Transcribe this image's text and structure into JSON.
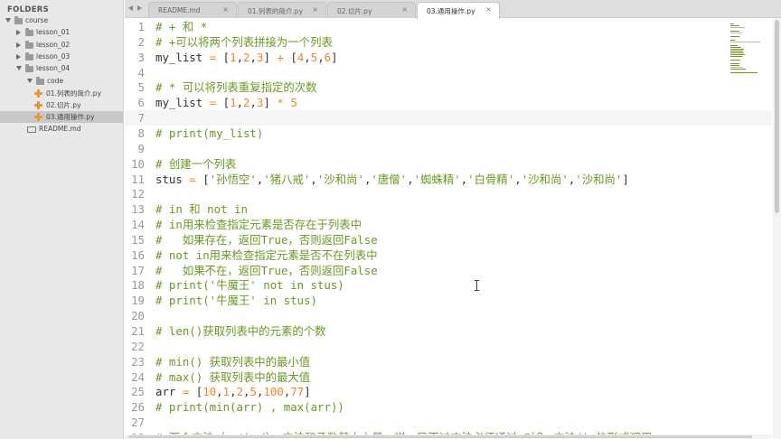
{
  "sidebar": {
    "title": "FOLDERS",
    "tree": [
      {
        "label": "course",
        "kind": "folder",
        "open": true,
        "depth": 0
      },
      {
        "label": "lesson_01",
        "kind": "folder",
        "open": false,
        "depth": 1
      },
      {
        "label": "lesson_02",
        "kind": "folder",
        "open": false,
        "depth": 1
      },
      {
        "label": "lesson_03",
        "kind": "folder",
        "open": false,
        "depth": 1
      },
      {
        "label": "lesson_04",
        "kind": "folder",
        "open": true,
        "depth": 1
      },
      {
        "label": "code",
        "kind": "folder",
        "open": true,
        "depth": 2
      },
      {
        "label": "01.列表的简介.py",
        "kind": "py",
        "depth": 3
      },
      {
        "label": "02.切片.py",
        "kind": "py",
        "depth": 3
      },
      {
        "label": "03.通用操作.py",
        "kind": "py",
        "depth": 3,
        "selected": true
      },
      {
        "label": "README.md",
        "kind": "md",
        "depth": 2
      }
    ]
  },
  "tabs": [
    {
      "label": "README.md",
      "close": "×"
    },
    {
      "label": "01.列表的简介.py",
      "close": "×"
    },
    {
      "label": "02.切片.py",
      "close": "×"
    },
    {
      "label": "03.通用操作.py",
      "close": "×",
      "active": true
    }
  ],
  "editor": {
    "current_line": 7,
    "lines": [
      {
        "n": "1",
        "tokens": [
          [
            "cm",
            "# + 和 *"
          ]
        ]
      },
      {
        "n": "2",
        "tokens": [
          [
            "cm",
            "# +可以将两个列表拼接为一个列表"
          ]
        ]
      },
      {
        "n": "3",
        "tokens": [
          [
            "pl",
            "my_list "
          ],
          [
            "op",
            "="
          ],
          [
            "pl",
            " "
          ],
          [
            "pn",
            "["
          ],
          [
            "nm",
            "1"
          ],
          [
            "pn",
            ","
          ],
          [
            "nm",
            "2"
          ],
          [
            "pn",
            ","
          ],
          [
            "nm",
            "3"
          ],
          [
            "pn",
            "]"
          ],
          [
            "pl",
            " "
          ],
          [
            "op",
            "+"
          ],
          [
            "pl",
            " "
          ],
          [
            "pn",
            "["
          ],
          [
            "nm",
            "4"
          ],
          [
            "pn",
            ","
          ],
          [
            "nm",
            "5"
          ],
          [
            "pn",
            ","
          ],
          [
            "nm",
            "6"
          ],
          [
            "pn",
            "]"
          ]
        ]
      },
      {
        "n": "4",
        "tokens": []
      },
      {
        "n": "5",
        "tokens": [
          [
            "cm",
            "# * 可以将列表重复指定的次数"
          ]
        ]
      },
      {
        "n": "6",
        "tokens": [
          [
            "pl",
            "my_list "
          ],
          [
            "op",
            "="
          ],
          [
            "pl",
            " "
          ],
          [
            "pn",
            "["
          ],
          [
            "nm",
            "1"
          ],
          [
            "pn",
            ","
          ],
          [
            "nm",
            "2"
          ],
          [
            "pn",
            ","
          ],
          [
            "nm",
            "3"
          ],
          [
            "pn",
            "]"
          ],
          [
            "pl",
            " "
          ],
          [
            "op",
            "*"
          ],
          [
            "pl",
            " "
          ],
          [
            "nm",
            "5"
          ]
        ]
      },
      {
        "n": "7",
        "tokens": []
      },
      {
        "n": "8",
        "tokens": [
          [
            "cm",
            "# print(my_list)"
          ]
        ]
      },
      {
        "n": "9",
        "tokens": []
      },
      {
        "n": "10",
        "tokens": [
          [
            "cm",
            "# 创建一个列表"
          ]
        ]
      },
      {
        "n": "11",
        "tokens": [
          [
            "pl",
            "stus "
          ],
          [
            "op",
            "="
          ],
          [
            "pl",
            " "
          ],
          [
            "pn",
            "["
          ],
          [
            "st",
            "'孙悟空'"
          ],
          [
            "pn",
            ","
          ],
          [
            "st",
            "'猪八戒'"
          ],
          [
            "pn",
            ","
          ],
          [
            "st",
            "'沙和尚'"
          ],
          [
            "pn",
            ","
          ],
          [
            "st",
            "'唐僧'"
          ],
          [
            "pn",
            ","
          ],
          [
            "st",
            "'蜘蛛精'"
          ],
          [
            "pn",
            ","
          ],
          [
            "st",
            "'白骨精'"
          ],
          [
            "pn",
            ","
          ],
          [
            "st",
            "'沙和尚'"
          ],
          [
            "pn",
            ","
          ],
          [
            "st",
            "'沙和尚'"
          ],
          [
            "pn",
            "]"
          ]
        ]
      },
      {
        "n": "12",
        "tokens": []
      },
      {
        "n": "13",
        "tokens": [
          [
            "cm",
            "# in 和 not in"
          ]
        ]
      },
      {
        "n": "14",
        "tokens": [
          [
            "cm",
            "# in用来检查指定元素是否存在于列表中"
          ]
        ]
      },
      {
        "n": "15",
        "tokens": [
          [
            "cm",
            "#   如果存在，返回True，否则返回False"
          ]
        ]
      },
      {
        "n": "16",
        "tokens": [
          [
            "cm",
            "# not in用来检查指定元素是否不在列表中"
          ]
        ]
      },
      {
        "n": "17",
        "tokens": [
          [
            "cm",
            "#   如果不在，返回True，否则返回False"
          ]
        ]
      },
      {
        "n": "18",
        "tokens": [
          [
            "cm",
            "# print('牛魔王' not in stus)"
          ]
        ]
      },
      {
        "n": "19",
        "tokens": [
          [
            "cm",
            "# print('牛魔王' in stus)"
          ]
        ]
      },
      {
        "n": "20",
        "tokens": []
      },
      {
        "n": "21",
        "tokens": [
          [
            "cm",
            "# len()获取列表中的元素的个数"
          ]
        ]
      },
      {
        "n": "22",
        "tokens": []
      },
      {
        "n": "23",
        "tokens": [
          [
            "cm",
            "# min() 获取列表中的最小值"
          ]
        ]
      },
      {
        "n": "24",
        "tokens": [
          [
            "cm",
            "# max() 获取列表中的最大值"
          ]
        ]
      },
      {
        "n": "25",
        "tokens": [
          [
            "pl",
            "arr "
          ],
          [
            "op",
            "="
          ],
          [
            "pl",
            " "
          ],
          [
            "pn",
            "["
          ],
          [
            "nm",
            "10"
          ],
          [
            "pn",
            ","
          ],
          [
            "nm",
            "1"
          ],
          [
            "pn",
            ","
          ],
          [
            "nm",
            "2"
          ],
          [
            "pn",
            ","
          ],
          [
            "nm",
            "5"
          ],
          [
            "pn",
            ","
          ],
          [
            "nm",
            "100"
          ],
          [
            "pn",
            ","
          ],
          [
            "nm",
            "77"
          ],
          [
            "pn",
            "]"
          ]
        ]
      },
      {
        "n": "26",
        "tokens": [
          [
            "cm",
            "# print(min(arr) , max(arr))"
          ]
        ]
      },
      {
        "n": "27",
        "tokens": []
      },
      {
        "n": "28",
        "tokens": [
          [
            "cm",
            "# 两个方法（method），方法和函数基本上是一样，只不过方法必须通过 对象.方法() 的形式调用"
          ]
        ]
      }
    ]
  },
  "colors": {
    "comment": "#6a9a1f",
    "number": "#f5871f",
    "operator": "#f5871f",
    "text": "#333333",
    "line_number": "#999999",
    "sidebar_bg": "#e8e8e8",
    "selected_row": "#c8c8c8",
    "python_icon": "#f0932b"
  },
  "icons": {
    "nav_prev": "triangle-left-icon",
    "nav_next": "triangle-right-icon",
    "folder": "folder-icon",
    "python_file": "python-file-icon",
    "markdown_file": "markdown-file-icon",
    "text_cursor": "ibeam-cursor-icon"
  }
}
